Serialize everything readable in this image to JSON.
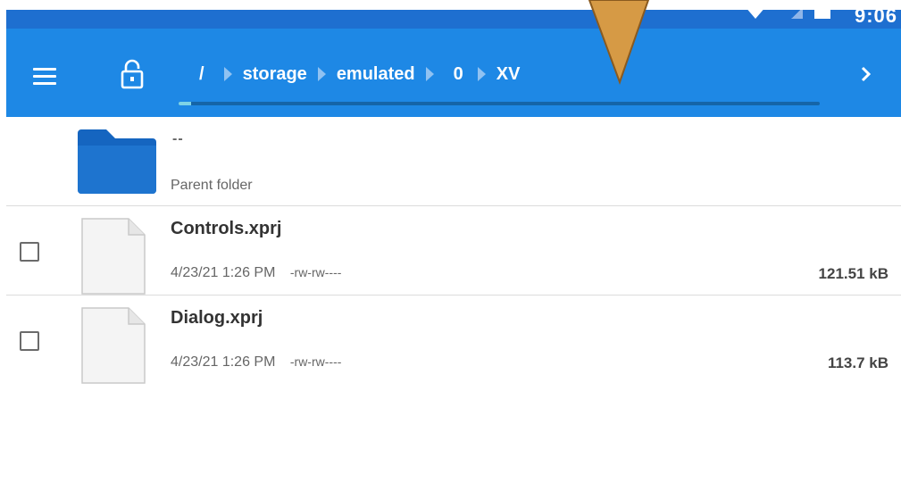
{
  "status_bar": {
    "time": "9:06",
    "wifi_icon": "wifi-icon",
    "cell_icon": "cell-signal-icon",
    "battery_icon": "battery-icon"
  },
  "toolbar": {
    "menu_icon": "menu-icon",
    "lock_icon": "lock-icon",
    "breadcrumb": {
      "root": "/",
      "items": [
        "storage",
        "emulated",
        "0",
        "XV"
      ],
      "next_icon": "chevron-right-icon"
    },
    "progress_fraction": 0.02
  },
  "list": {
    "parent": {
      "name": "--",
      "subtitle": "Parent folder",
      "icon": "folder-icon"
    },
    "files": [
      {
        "name": "Controls.xprj",
        "date": "4/23/21 1:26 PM",
        "permissions": "-rw-rw----",
        "size": "121.51 kB",
        "icon": "file-icon"
      },
      {
        "name": "Dialog.xprj",
        "date": "4/23/21 1:26 PM",
        "permissions": "-rw-rw----",
        "size": "113.7 kB",
        "icon": "file-icon"
      }
    ]
  },
  "colors": {
    "toolbar": "#1e88e5",
    "status_bar": "#1e6fd0",
    "folder": "#1565c0",
    "pointer": "#d69a45"
  }
}
